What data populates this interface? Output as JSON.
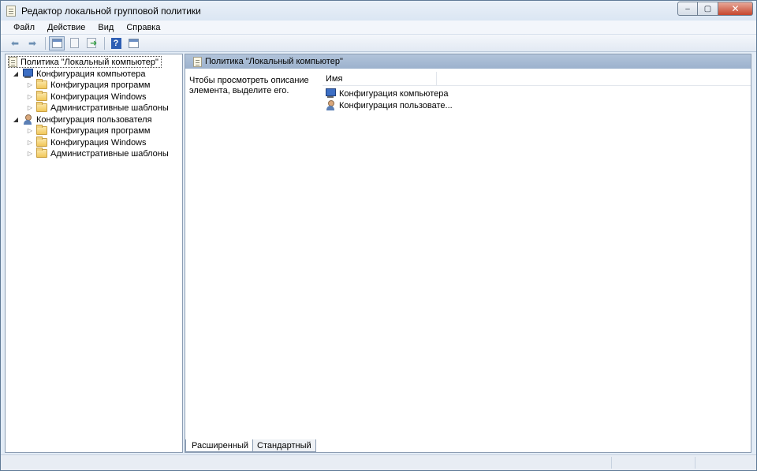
{
  "window": {
    "title": "Редактор локальной групповой политики",
    "controls": {
      "minimize": "–",
      "maximize": "▢",
      "close": "✕"
    }
  },
  "menu": [
    "Файл",
    "Действие",
    "Вид",
    "Справка"
  ],
  "toolbar": {
    "back_icon": "arrow-left-icon",
    "forward_icon": "arrow-right-icon",
    "help_glyph": "?"
  },
  "tree": {
    "root": "Политика \"Локальный компьютер\"",
    "computer": {
      "label": "Конфигурация компьютера",
      "children": [
        "Конфигурация программ",
        "Конфигурация Windows",
        "Административные шаблоны"
      ]
    },
    "user": {
      "label": "Конфигурация пользователя",
      "children": [
        "Конфигурация программ",
        "Конфигурация Windows",
        "Административные шаблоны"
      ]
    }
  },
  "right": {
    "header": "Политика \"Локальный компьютер\"",
    "description": "Чтобы просмотреть описание элемента, выделите его.",
    "column_name": "Имя",
    "items": [
      "Конфигурация компьютера",
      "Конфигурация пользовате..."
    ]
  },
  "tabs": [
    "Расширенный",
    "Стандартный"
  ]
}
